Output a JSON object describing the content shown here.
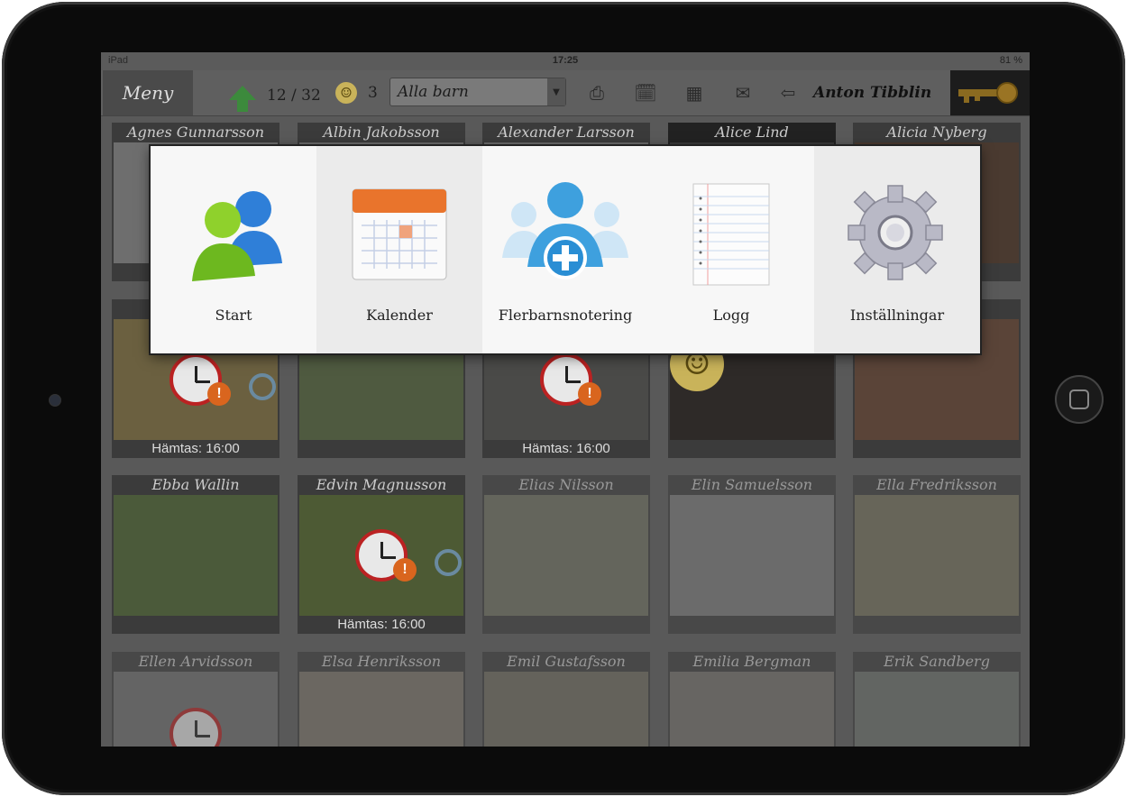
{
  "status_bar": {
    "device": "iPad",
    "time": "17:25",
    "battery": "81 %"
  },
  "toolbar": {
    "menu_label": "Meny",
    "present_count": "12 / 32",
    "smiley_count": "3",
    "group_select": "Alla barn",
    "user_name": "Anton Tibblin",
    "icons": [
      "arrow-up-icon",
      "smiley-icon",
      "printer-icon",
      "calendar-check-icon",
      "calendar-icon",
      "mail-icon",
      "logout-door-icon",
      "key-icon"
    ]
  },
  "menu": {
    "items": [
      {
        "label": "Start",
        "icon": "users-icon"
      },
      {
        "label": "Kalender",
        "icon": "calendar-icon"
      },
      {
        "label": "Flerbarnsnotering",
        "icon": "group-add-icon"
      },
      {
        "label": "Logg",
        "icon": "notepad-icon"
      },
      {
        "label": "Inställningar",
        "icon": "gear-icon"
      }
    ]
  },
  "children": [
    {
      "name": "Agnes Gunnarsson",
      "pickup": ""
    },
    {
      "name": "Albin Jakobsson",
      "pickup": ""
    },
    {
      "name": "Alexander Larsson",
      "pickup": ""
    },
    {
      "name": "Alice Lind",
      "pickup": ""
    },
    {
      "name": "Alicia Nyberg",
      "pickup": ""
    },
    {
      "name": "",
      "pickup": "Hämtas: 16:00"
    },
    {
      "name": "",
      "pickup": ""
    },
    {
      "name": "",
      "pickup": "Hämtas: 16:00"
    },
    {
      "name": "",
      "pickup": ""
    },
    {
      "name": "",
      "pickup": ""
    },
    {
      "name": "Ebba Wallin",
      "pickup": ""
    },
    {
      "name": "Edvin Magnusson",
      "pickup": "Hämtas: 16:00"
    },
    {
      "name": "Elias Nilsson",
      "pickup": ""
    },
    {
      "name": "Elin Samuelsson",
      "pickup": ""
    },
    {
      "name": "Ella Fredriksson",
      "pickup": ""
    },
    {
      "name": "Ellen Arvidsson",
      "pickup": ""
    },
    {
      "name": "Elsa Henriksson",
      "pickup": ""
    },
    {
      "name": "Emil Gustafsson",
      "pickup": ""
    },
    {
      "name": "Emilia Bergman",
      "pickup": ""
    },
    {
      "name": "Erik Sandberg",
      "pickup": ""
    }
  ],
  "colors": {
    "screen_bg": "#595959",
    "popup_bg": "#f7f7f7",
    "accent_green": "#3c8a3c",
    "warn_orange": "#d9651e"
  }
}
